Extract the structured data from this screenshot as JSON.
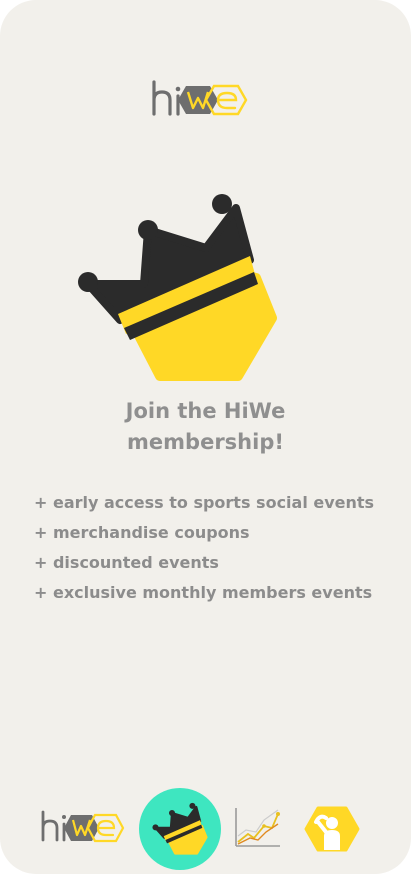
{
  "app": {
    "logo_text": "hiWe"
  },
  "hero": {
    "headline_line1": "Join the HiWe",
    "headline_line2": "membership!"
  },
  "benefits": [
    "+ early access to sports social events",
    "+ merchandise coupons",
    "+ discounted events",
    "+ exclusive monthly members events"
  ],
  "nav": {
    "items": [
      {
        "icon": "hiwe-logo-icon",
        "active": false
      },
      {
        "icon": "crown-icon",
        "active": true
      },
      {
        "icon": "stats-chart-icon",
        "active": false
      },
      {
        "icon": "profile-icon",
        "active": false
      }
    ]
  },
  "colors": {
    "background": "#f2f0eb",
    "accent_yellow": "#ffd826",
    "crown_dark": "#2b2b2b",
    "nav_active": "#3ee6c0",
    "text_gray": "#8f8f8f"
  }
}
